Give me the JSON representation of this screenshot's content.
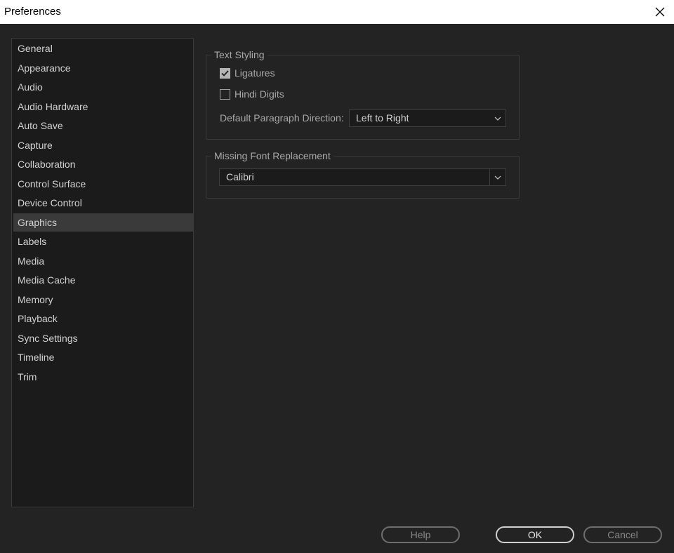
{
  "window": {
    "title": "Preferences"
  },
  "sidebar": {
    "items": [
      {
        "label": "General"
      },
      {
        "label": "Appearance"
      },
      {
        "label": "Audio"
      },
      {
        "label": "Audio Hardware"
      },
      {
        "label": "Auto Save"
      },
      {
        "label": "Capture"
      },
      {
        "label": "Collaboration"
      },
      {
        "label": "Control Surface"
      },
      {
        "label": "Device Control"
      },
      {
        "label": "Graphics"
      },
      {
        "label": "Labels"
      },
      {
        "label": "Media"
      },
      {
        "label": "Media Cache"
      },
      {
        "label": "Memory"
      },
      {
        "label": "Playback"
      },
      {
        "label": "Sync Settings"
      },
      {
        "label": "Timeline"
      },
      {
        "label": "Trim"
      }
    ],
    "selected": "Graphics"
  },
  "text_styling": {
    "title": "Text Styling",
    "ligatures": {
      "label": "Ligatures",
      "checked": true
    },
    "hindi_digits": {
      "label": "Hindi Digits",
      "checked": false
    },
    "paragraph_direction": {
      "label": "Default Paragraph Direction:",
      "value": "Left to Right"
    }
  },
  "missing_font": {
    "title": "Missing Font Replacement",
    "value": "Calibri"
  },
  "buttons": {
    "help": "Help",
    "ok": "OK",
    "cancel": "Cancel"
  },
  "colors": {
    "background": "#232323",
    "panel": "#1b1b1b",
    "selected": "#3a3a3a",
    "text": "#d2d2d2"
  }
}
